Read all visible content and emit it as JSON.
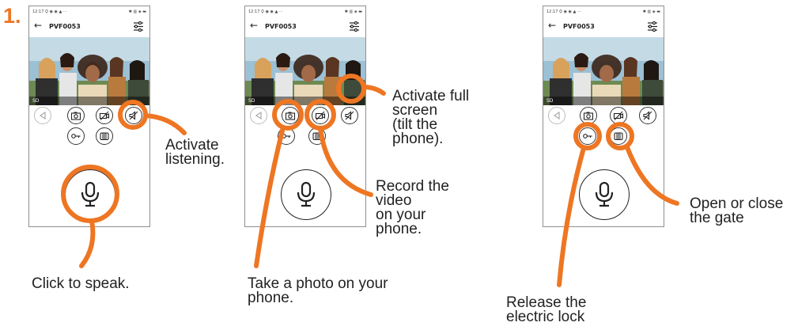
{
  "step_number": "1.",
  "phone": {
    "status_time": "12:17",
    "status_icons_left": "⛭ ◉ ◉ ▲ ···",
    "status_icons_right": "✱ ▥ ◈ ▬",
    "title": "PVF0053",
    "back_icon": "arrow-left-icon",
    "settings_icon": "sliders-icon",
    "stream_quality": "SD"
  },
  "labels": {
    "listening": "Activate\nlistening.",
    "speak": "Click to speak.",
    "fullscreen": "Activate full\nscreen\n(tilt the\nphone).",
    "record": "Record the\nvideo\non your\nphone.",
    "photo": "Take a photo on your\nphone.",
    "gate": "Open or close\nthe gate",
    "lock": "Release the\nelectric lock"
  },
  "colors": {
    "accent": "#ee7623",
    "text": "#222222"
  }
}
